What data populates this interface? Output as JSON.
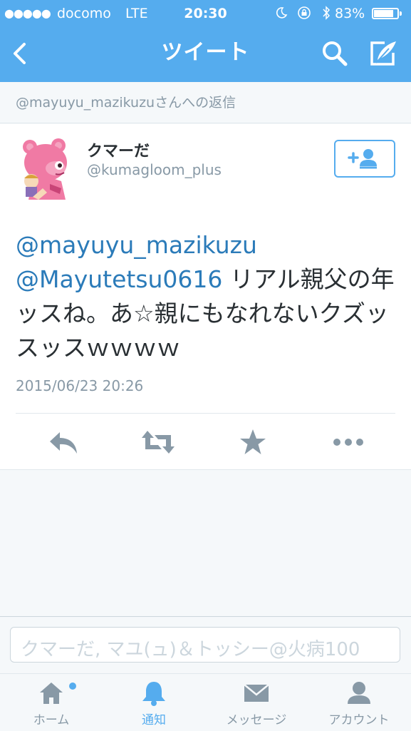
{
  "status_bar": {
    "signal": "●●●●●",
    "carrier": "docomo",
    "network": "LTE",
    "time": "20:30",
    "battery_percent": "83%",
    "battery_level": 0.83,
    "icons": [
      "moon-icon",
      "rotation-lock-icon",
      "bluetooth-icon",
      "battery-icon"
    ]
  },
  "nav": {
    "title": "ツイート",
    "icons": [
      "back-arrow-icon",
      "search-icon",
      "compose-icon"
    ]
  },
  "reply_context": "@mayuyu_mazikuzuさんへの返信",
  "tweet": {
    "user_name": "クマーだ",
    "user_handle": "@kumagloom_plus",
    "mention_1": "@mayuyu_mazikuzu",
    "mention_2": "@Mayutetsu0616",
    "body": " リアル親父の年ッスね。あ☆親にもなれないクズッスッスｗｗｗｗ",
    "timestamp": "2015/06/23 20:26",
    "actions": [
      "reply-icon",
      "retweet-icon",
      "favorite-star-icon",
      "more-icon"
    ]
  },
  "compose": {
    "placeholder": "クマーだ, マユ(ュ)＆トッシー@火病100"
  },
  "tabbar": {
    "items": [
      {
        "label": "ホーム",
        "icon": "home-icon"
      },
      {
        "label": "通知",
        "icon": "bell-icon"
      },
      {
        "label": "メッセージ",
        "icon": "envelope-icon"
      },
      {
        "label": "アカウント",
        "icon": "person-icon"
      }
    ]
  },
  "colors": {
    "brand": "#55acee",
    "link": "#2b7bb9",
    "muted": "#8899a6",
    "text": "#292f33"
  }
}
